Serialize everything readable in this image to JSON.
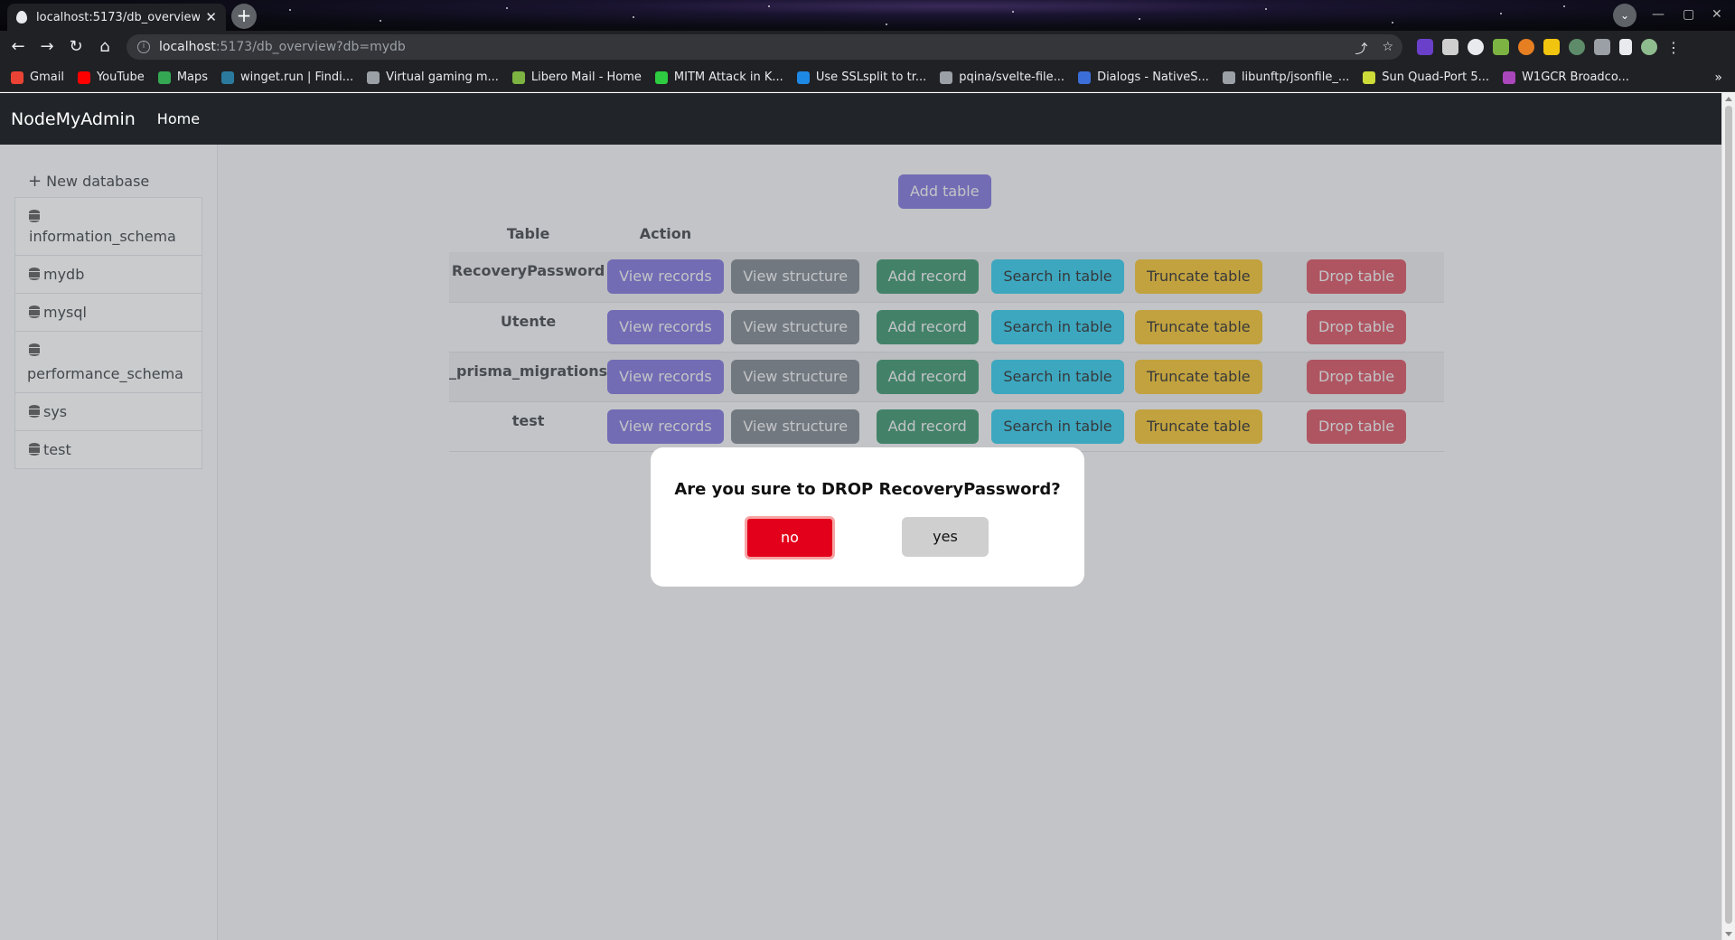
{
  "browser": {
    "tab_title": "localhost:5173/db_overview?",
    "tab_close": "✕",
    "new_tab": "+",
    "url_host": "localhost",
    "url_rest": ":5173/db_overview?db=mydb",
    "bookmarks": [
      {
        "label": "Gmail",
        "color": "#ea4335"
      },
      {
        "label": "YouTube",
        "color": "#ff0000"
      },
      {
        "label": "Maps",
        "color": "#34a853"
      },
      {
        "label": "winget.run | Findi...",
        "color": "#2b7a9e"
      },
      {
        "label": "Virtual gaming m...",
        "color": "#9aa0a6"
      },
      {
        "label": "Libero Mail - Home",
        "color": "#7cb342"
      },
      {
        "label": "MITM Attack in K...",
        "color": "#2ecc40"
      },
      {
        "label": "Use SSLsplit to tr...",
        "color": "#1e88e5"
      },
      {
        "label": "pqina/svelte-file...",
        "color": "#9aa0a6"
      },
      {
        "label": "Dialogs - NativeS...",
        "color": "#3b6ed8"
      },
      {
        "label": "libunftp/jsonfile_...",
        "color": "#9aa0a6"
      },
      {
        "label": "Sun Quad-Port 5...",
        "color": "#cddc39"
      },
      {
        "label": "W1GCR Broadco...",
        "color": "#ab47bc"
      }
    ],
    "bookmarks_more": "»"
  },
  "app": {
    "brand": "NodeMyAdmin",
    "nav_home": "Home",
    "new_database": "New database",
    "databases": [
      "information_schema",
      "mydb",
      "mysql",
      "performance_schema",
      "sys",
      "test"
    ],
    "add_table": "Add table",
    "table_header": {
      "table": "Table",
      "action": "Action"
    },
    "tables": [
      "RecoveryPassword",
      "Utente",
      "_prisma_migrations",
      "test"
    ],
    "actions": {
      "view_records": "View records",
      "view_structure": "View structure",
      "add_record": "Add record",
      "search": "Search in table",
      "truncate": "Truncate table",
      "drop": "Drop table"
    }
  },
  "modal": {
    "question": "Are you sure to DROP RecoveryPassword?",
    "no": "no",
    "yes": "yes"
  }
}
